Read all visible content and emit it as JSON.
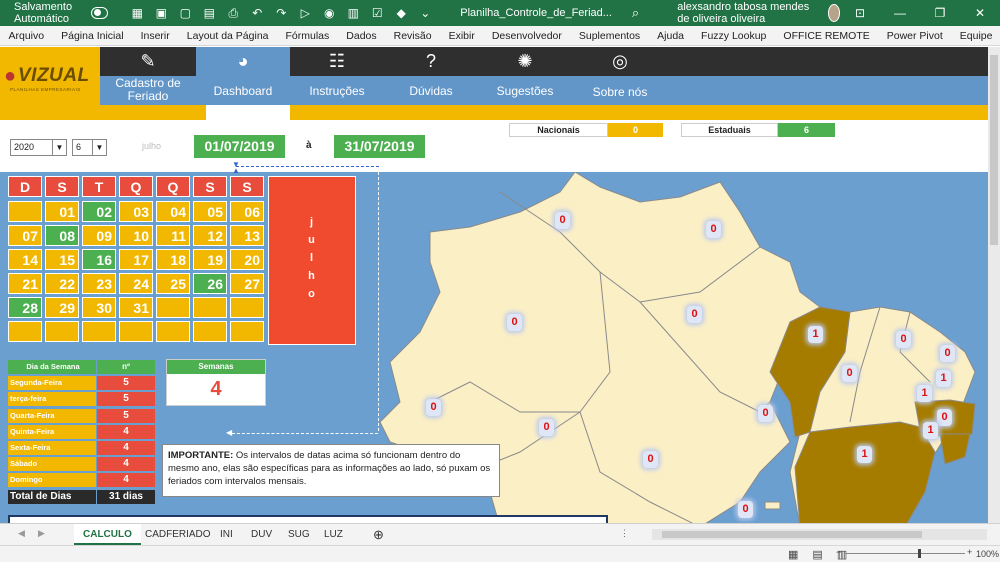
{
  "titlebar": {
    "autosave_label": "Salvamento Automático",
    "filename": "Planilha_Controle_de_Feriad...",
    "user": "alexsandro tabosa mendes de oliveira oliveira"
  },
  "ribbon": {
    "tabs": [
      "Arquivo",
      "Página Inicial",
      "Inserir",
      "Layout da Página",
      "Fórmulas",
      "Dados",
      "Revisão",
      "Exibir",
      "Desenvolvedor",
      "Suplementos",
      "Ajuda",
      "Fuzzy Lookup",
      "OFFICE REMOTE",
      "Power Pivot",
      "Equipe"
    ]
  },
  "logo": {
    "brand": "VIZUAL",
    "sub": "PLANILHAS EMPRESARIAIS"
  },
  "nav": {
    "cadastro": "Cadastro de Feriado",
    "dashboard": "Dashboard",
    "instrucoes": "Instruções",
    "duvidas": "Dúvidas",
    "sugestoes": "Sugestões",
    "sobre": "Sobre nós"
  },
  "controls": {
    "year": "2020",
    "month": "6",
    "month_name": "julho",
    "start_date": "01/07/2019",
    "to_label": "à",
    "end_date": "31/07/2019"
  },
  "kpis": {
    "nacionais_label": "Nacionais",
    "nacionais_value": "0",
    "estaduais_label": "Estaduais",
    "estaduais_value": "6"
  },
  "calendar": {
    "headers": [
      "D",
      "S",
      "T",
      "Q",
      "Q",
      "S",
      "S"
    ],
    "month_vertical": "j u l h o",
    "weeks": [
      [
        {
          "d": "",
          "c": "y"
        },
        {
          "d": "01",
          "c": "y"
        },
        {
          "d": "02",
          "c": "g"
        },
        {
          "d": "03",
          "c": "y"
        },
        {
          "d": "04",
          "c": "y"
        },
        {
          "d": "05",
          "c": "y"
        },
        {
          "d": "06",
          "c": "y"
        }
      ],
      [
        {
          "d": "07",
          "c": "y"
        },
        {
          "d": "08",
          "c": "g"
        },
        {
          "d": "09",
          "c": "y"
        },
        {
          "d": "10",
          "c": "y"
        },
        {
          "d": "11",
          "c": "y"
        },
        {
          "d": "12",
          "c": "y"
        },
        {
          "d": "13",
          "c": "y"
        }
      ],
      [
        {
          "d": "14",
          "c": "y"
        },
        {
          "d": "15",
          "c": "y"
        },
        {
          "d": "16",
          "c": "g"
        },
        {
          "d": "17",
          "c": "y"
        },
        {
          "d": "18",
          "c": "y"
        },
        {
          "d": "19",
          "c": "y"
        },
        {
          "d": "20",
          "c": "y"
        }
      ],
      [
        {
          "d": "21",
          "c": "y"
        },
        {
          "d": "22",
          "c": "y"
        },
        {
          "d": "23",
          "c": "y"
        },
        {
          "d": "24",
          "c": "y"
        },
        {
          "d": "25",
          "c": "y"
        },
        {
          "d": "26",
          "c": "g"
        },
        {
          "d": "27",
          "c": "y"
        }
      ],
      [
        {
          "d": "28",
          "c": "g"
        },
        {
          "d": "29",
          "c": "y"
        },
        {
          "d": "30",
          "c": "y"
        },
        {
          "d": "31",
          "c": "y"
        },
        {
          "d": "",
          "c": "y"
        },
        {
          "d": "",
          "c": "y"
        },
        {
          "d": "",
          "c": "y"
        }
      ],
      [
        {
          "d": "",
          "c": "y"
        },
        {
          "d": "",
          "c": "y"
        },
        {
          "d": "",
          "c": "y"
        },
        {
          "d": "",
          "c": "y"
        },
        {
          "d": "",
          "c": "y"
        },
        {
          "d": "",
          "c": "y"
        },
        {
          "d": "",
          "c": "y"
        }
      ]
    ]
  },
  "weekday_table": {
    "header_name": "Dia da Semana",
    "header_value": "nº",
    "rows": [
      {
        "name": "Segunda-Feira",
        "value": "5"
      },
      {
        "name": "terça-feira",
        "value": "5"
      },
      {
        "name": "Quarta-Feira",
        "value": "5"
      },
      {
        "name": "Quinta-Feira",
        "value": "4"
      },
      {
        "name": "Sexta-Feira",
        "value": "4"
      },
      {
        "name": "Sábado",
        "value": "4"
      },
      {
        "name": "Domingo",
        "value": "4"
      }
    ],
    "total_label": "Total de Dias",
    "total_value": "31 dias"
  },
  "semanas": {
    "label": "Semanas",
    "value": "4"
  },
  "note": {
    "bold": "IMPORTANTE:",
    "text": " Os intervalos de datas acima só funcionam dentro do mesmo ano, elas são específicas para as informações ao lado, só puxam os feriados com intervalos mensais."
  },
  "map_badges": [
    "0",
    "0",
    "0",
    "0",
    "1",
    "0",
    "0",
    "0",
    "1",
    "0",
    "1",
    "0",
    "0",
    "0",
    "1",
    "0",
    "0",
    "1",
    "0"
  ],
  "colors": {
    "excel_green": "#217346",
    "nav_dark": "#2f2f2f",
    "nav_blue": "#6296c8",
    "accent_yellow": "#f2b800",
    "holiday_green": "#4caf50",
    "header_red": "#e74c3c",
    "map_land": "#fbefc6",
    "map_highlight": "#a67c00"
  },
  "sheet_tabs": [
    "CALCULO",
    "CADFERIADO",
    "INI",
    "DUV",
    "SUG",
    "LUZ"
  ],
  "status": {
    "zoom": "100%"
  }
}
